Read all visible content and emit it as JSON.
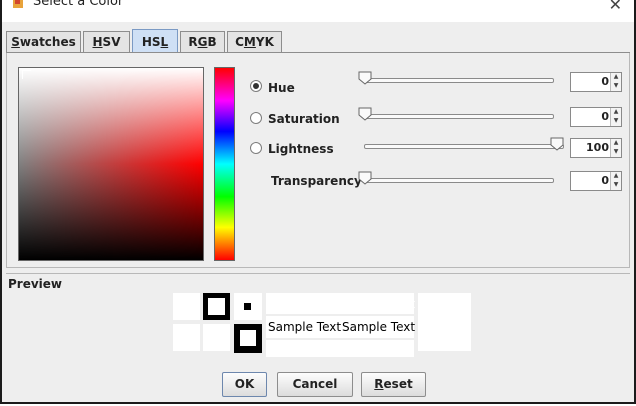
{
  "window": {
    "title": "Select a Color",
    "close_glyph": "✕",
    "icon": "java-cup-icon"
  },
  "tabs": [
    {
      "pre": "",
      "mn": "S",
      "post": "watches",
      "active": false
    },
    {
      "pre": "",
      "mn": "H",
      "post": "SV",
      "active": false
    },
    {
      "pre": "HS",
      "mn": "L",
      "post": "",
      "active": true
    },
    {
      "pre": "R",
      "mn": "G",
      "post": "B",
      "active": false
    },
    {
      "pre": "C",
      "mn": "M",
      "post": "YK",
      "active": false
    }
  ],
  "controls": {
    "hue": {
      "label": "Hue",
      "value": "0",
      "selected": true
    },
    "saturation": {
      "label": "Saturation",
      "value": "0",
      "selected": false
    },
    "lightness": {
      "label": "Lightness",
      "value": "100",
      "selected": false
    },
    "transparency": {
      "label": "Transparency",
      "value": "0"
    }
  },
  "preview": {
    "label": "Preview",
    "sample_text_1": "Sample Text",
    "sample_text_2": "Sample Text"
  },
  "buttons": {
    "ok": "OK",
    "cancel": "Cancel",
    "reset_mn": "R",
    "reset_rest": "eset"
  },
  "colors": {
    "tab_active": "#cfe0f5",
    "dialog_bg": "#eeeeee"
  }
}
